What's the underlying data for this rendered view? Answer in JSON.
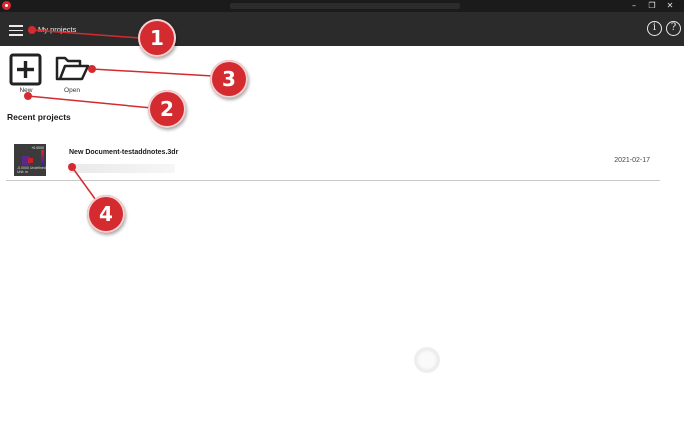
{
  "window": {
    "minimize_glyph": "–",
    "restore_glyph": "❐",
    "close_glyph": "✕"
  },
  "header": {
    "title": "My projects",
    "info_glyph": "i",
    "help_glyph": "?"
  },
  "toolbar": {
    "new_label": "New",
    "open_label": "Open"
  },
  "recent": {
    "title": "Recent projects",
    "items": [
      {
        "name": "New Document-testaddnotes.3dr",
        "date": "2021-02-17",
        "thumb_text_top": "+0.0000",
        "thumb_text_bottom": "-0.0000 Undefined Unit: m"
      }
    ]
  },
  "annotations": [
    "1",
    "2",
    "3",
    "4"
  ],
  "colors": {
    "callout": "#d32b2f",
    "header_bg": "#2b2b2b",
    "titlebar_bg": "#1b1b1b"
  }
}
